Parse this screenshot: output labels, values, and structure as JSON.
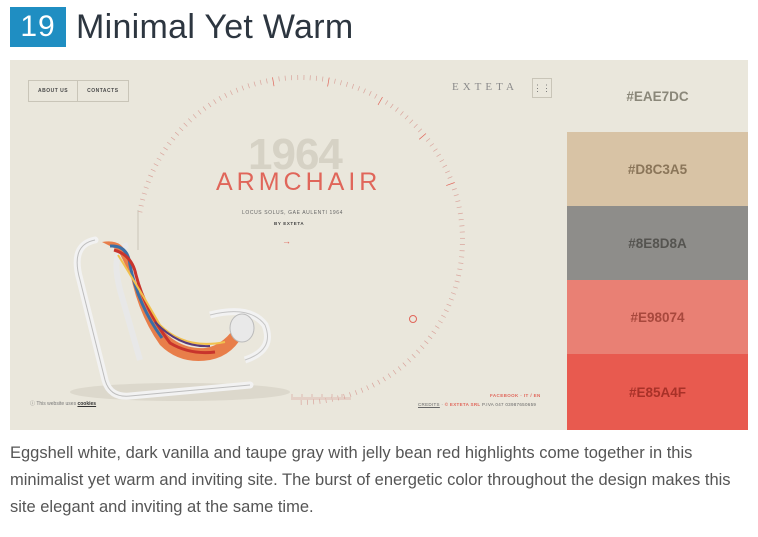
{
  "header": {
    "number": "19",
    "title": "Minimal Yet Warm"
  },
  "site": {
    "nav": [
      "ABOUT US",
      "CONTACTS"
    ],
    "logo": "EXTETA",
    "year": "1964",
    "product": "ARMCHAIR",
    "subtitle": "LOCUS SOLUS, GAE AULENTI 1964",
    "byline": "BY EXTETA",
    "arrow": "→",
    "cookie_prefix": "This website uses",
    "cookie_link": "cookies",
    "social": "FACEBOOK · IT / EN",
    "credits_link": "CREDITS",
    "credits_red": "© EXTETA SRL",
    "credits_rest": "P.IVA 047 03987650659"
  },
  "palette": [
    {
      "hex": "#EAE7DC",
      "text_color": "#8a8779"
    },
    {
      "hex": "#D8C3A5",
      "text_color": "#8a7559"
    },
    {
      "hex": "#8E8D8A",
      "text_color": "#555450"
    },
    {
      "hex": "#E98074",
      "text_color": "#a8483d"
    },
    {
      "hex": "#E85A4F",
      "text_color": "#a83128"
    }
  ],
  "caption": "Eggshell white, dark vanilla and taupe gray with jelly bean red highlights come together in this minimalist yet warm and inviting site. The burst of energetic color throughout the design makes this site elegant and inviting at the same time."
}
